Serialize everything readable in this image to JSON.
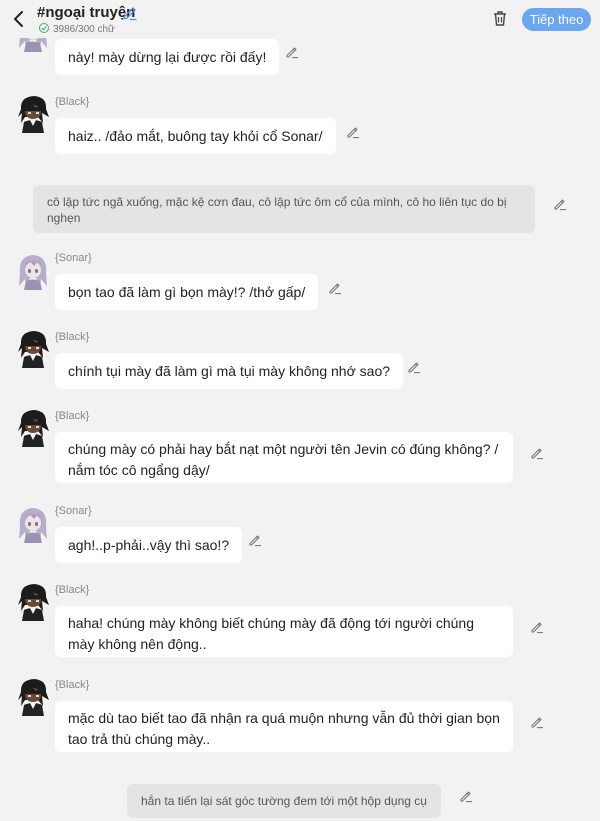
{
  "header": {
    "title": "#ngoại truyện",
    "subtitle": "3986/300 chữ",
    "next_label": "Tiếp theo"
  },
  "icons": {
    "back": "chevron-left-icon",
    "edit": "pencil-icon",
    "trash": "trash-icon",
    "check": "check-circle-icon"
  },
  "colors": {
    "accent": "#6aa7ee",
    "bubble": "#ffffff",
    "narration": "#e4e4e4",
    "background": "#f2f2f2"
  },
  "messages": [
    {
      "type": "dialog",
      "speaker": "",
      "character": "sonar",
      "text": "này! mày dừng lại được rồi đấy!"
    },
    {
      "type": "dialog",
      "speaker": "{Black}",
      "character": "black",
      "text": "haiz.. /đảo mắt, buông tay khỏi cổ Sonar/"
    },
    {
      "type": "narration",
      "text": "cô lập tức ngã xuống, mặc kệ cơn đau, cô lập tức ôm cổ của mình, cô ho liên tục do bị nghẹn"
    },
    {
      "type": "dialog",
      "speaker": "{Sonar}",
      "character": "sonar",
      "text": "bọn tao đã làm gì bọn mày!? /thở gấp/"
    },
    {
      "type": "dialog",
      "speaker": "{Black}",
      "character": "black",
      "text": "chính tụi mày đã làm gì mà tụi mày không nhớ sao?"
    },
    {
      "type": "dialog",
      "speaker": "{Black}",
      "character": "black",
      "text": "chúng mày có phải hay bắt nạt một người tên Jevin có đúng không? / nắm tóc cô ngẩng dậy/"
    },
    {
      "type": "dialog",
      "speaker": "{Sonar}",
      "character": "sonar",
      "text": "agh!..p-phải..vậy thì sao!?"
    },
    {
      "type": "dialog",
      "speaker": "{Black}",
      "character": "black",
      "text": "haha! chúng mày không biết chúng mày đã động tới người chúng mày không nên động.."
    },
    {
      "type": "dialog",
      "speaker": "{Black}",
      "character": "black",
      "text": "mặc dù tao biết tao đã nhận ra quá muộn nhưng vẫn đủ thời gian bọn tao trả thù chúng mày.."
    },
    {
      "type": "narration",
      "text": "hắn ta tiến lại sát góc tường đem tới một hộp dụng cụ"
    }
  ]
}
